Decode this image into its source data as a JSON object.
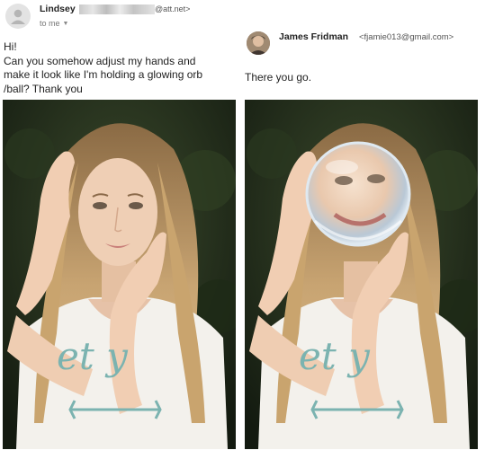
{
  "original_email": {
    "sender_name": "Lindsey",
    "sender_email": "@att.net>",
    "recipient_line": "to me",
    "body_lines": [
      "Hi!",
      "Can you somehow adjust my hands and",
      "make it look like I'm holding a glowing orb",
      "/ball? Thank you"
    ],
    "photo": {
      "shirt_text": "et y"
    }
  },
  "reply_email": {
    "sender_name": "James Fridman",
    "sender_email": "<fjamie013@gmail.com>",
    "body": "There you go.",
    "photo": {
      "shirt_text": "et y"
    }
  },
  "icons": [
    "default-avatar-icon",
    "chevron-down-icon"
  ]
}
